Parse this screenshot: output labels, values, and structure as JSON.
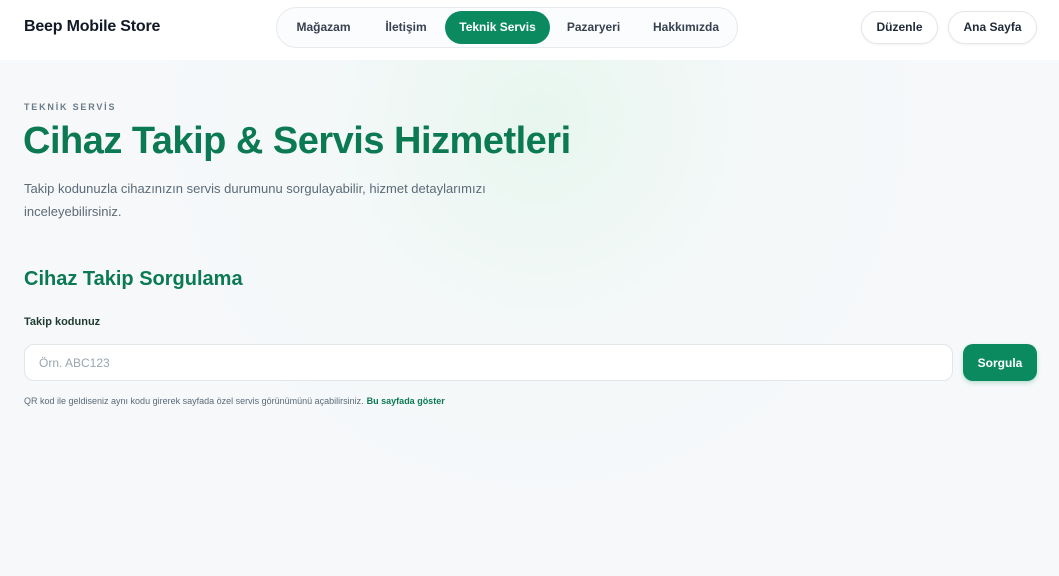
{
  "header": {
    "brand": "Beep Mobile Store",
    "nav": [
      "Mağazam",
      "İletişim",
      "Teknik Servis",
      "Pazaryeri",
      "Hakkımızda"
    ],
    "active_nav": "Teknik Servis",
    "edit_label": "Düzenle",
    "home_label": "Ana Sayfa"
  },
  "hero": {
    "eyebrow": "TEKNİK SERVİS",
    "title": "Cihaz Takip & Servis Hizmetleri",
    "description": "Takip kodunuzla cihazınızın servis durumunu sorgulayabilir, hizmet detaylarımızı inceleyebilirsiniz."
  },
  "tracking": {
    "section_title": "Cihaz Takip Sorgulama",
    "field_label": "Takip kodunuz",
    "placeholder": "Örn. ABC123",
    "value": "",
    "submit_label": "Sorgula",
    "hint_text": "QR kod ile geldiseniz aynı kodu girerek sayfada özel servis görünümünü açabilirsiniz.",
    "hint_link": "Bu sayfada göster"
  },
  "colors": {
    "accent": "#0a8a5e",
    "title": "#0b7a53",
    "background": "#f6f8fa"
  }
}
